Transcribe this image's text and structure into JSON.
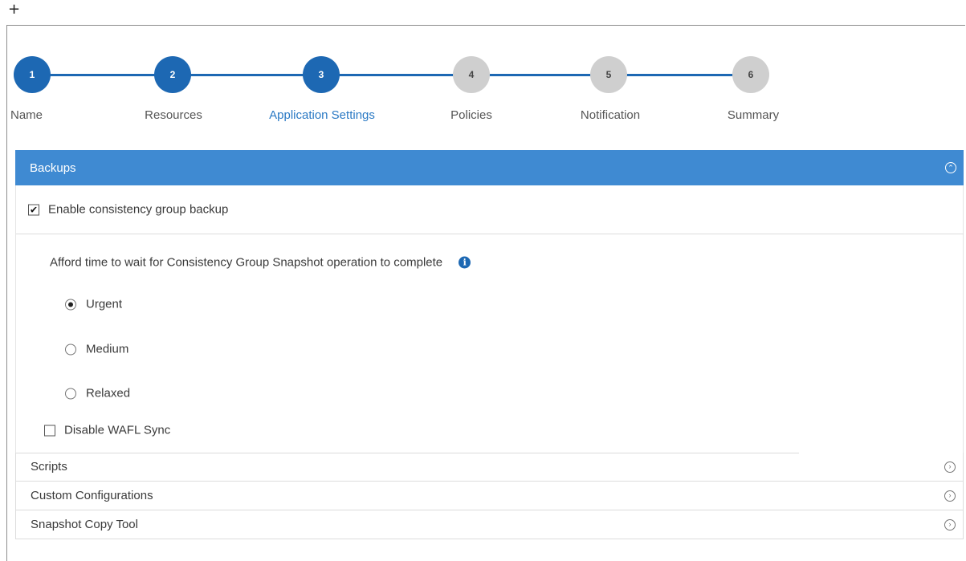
{
  "corner_symbol": "+",
  "wizard": {
    "steps": [
      {
        "number": "1",
        "label": "Name",
        "state": "done"
      },
      {
        "number": "2",
        "label": "Resources",
        "state": "done"
      },
      {
        "number": "3",
        "label": "Application Settings",
        "state": "active"
      },
      {
        "number": "4",
        "label": "Policies",
        "state": "todo"
      },
      {
        "number": "5",
        "label": "Notification",
        "state": "todo"
      },
      {
        "number": "6",
        "label": "Summary",
        "state": "todo"
      }
    ],
    "colors": {
      "done": "#1d68b3",
      "todo": "#cfcfcf"
    }
  },
  "backups": {
    "title": "Backups",
    "expand_icon": "chevron-up-circle-icon",
    "enable_cg": {
      "label": "Enable consistency group backup",
      "checked": true
    },
    "afford_label": "Afford time to wait for Consistency Group Snapshot operation to complete",
    "info_icon": "i",
    "options": [
      {
        "label": "Urgent",
        "selected": true
      },
      {
        "label": "Medium",
        "selected": false
      },
      {
        "label": "Relaxed",
        "selected": false
      }
    ],
    "disable_wafl": {
      "label": "Disable WAFL Sync",
      "checked": false
    }
  },
  "sections": [
    {
      "title": "Scripts",
      "icon": "chevron-right-circle-icon"
    },
    {
      "title": "Custom Configurations",
      "icon": "chevron-right-circle-icon"
    },
    {
      "title": "Snapshot Copy Tool",
      "icon": "chevron-right-circle-icon"
    }
  ],
  "accent_color": "#3f8ad2"
}
